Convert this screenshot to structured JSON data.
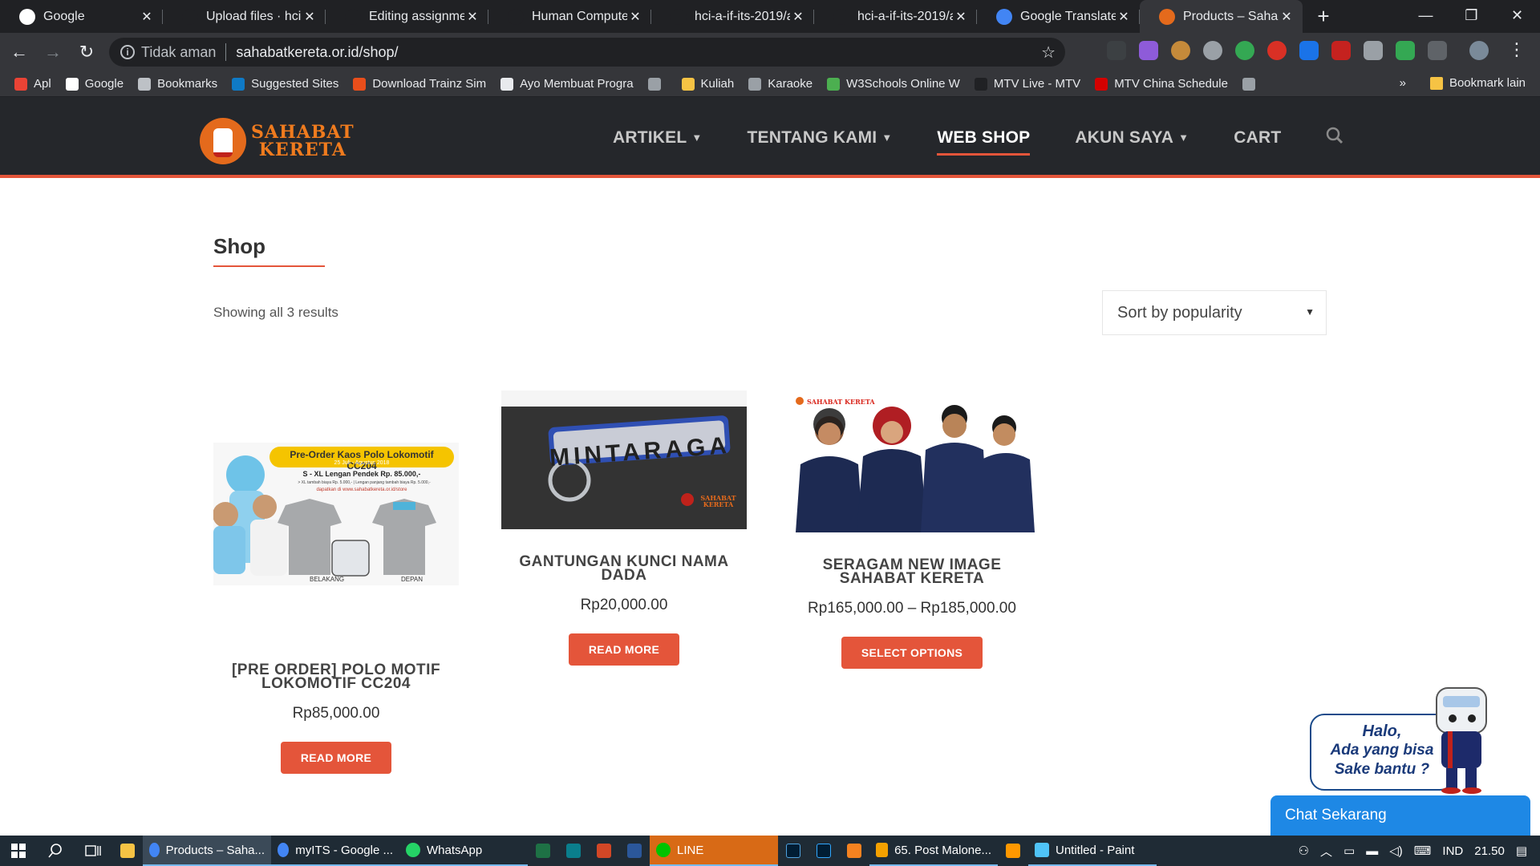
{
  "browser": {
    "tabs": [
      {
        "title": "Google",
        "icon": "google-icon",
        "color": "#ffffff"
      },
      {
        "title": "Upload files · hci-a",
        "icon": "github-icon",
        "color": "#202124"
      },
      {
        "title": "Editing assignment",
        "icon": "github-icon",
        "color": "#202124"
      },
      {
        "title": "Human Computer",
        "icon": "github-icon",
        "color": "#202124"
      },
      {
        "title": "hci-a-if-its-2019/a",
        "icon": "github-icon",
        "color": "#202124"
      },
      {
        "title": "hci-a-if-its-2019/a",
        "icon": "github-icon",
        "color": "#202124"
      },
      {
        "title": "Google Translate",
        "icon": "translate-icon",
        "color": "#4285f4"
      },
      {
        "title": "Products – Sahaba",
        "icon": "sahabat-kereta-icon",
        "color": "#e46a1c"
      }
    ],
    "close_glyph": "✕",
    "new_tab_glyph": "+",
    "address": {
      "security_label": "Tidak aman",
      "url": "sahabatkereta.or.id/shop/"
    },
    "bookmarks": [
      {
        "label": "Apl",
        "icon": "apps-icon",
        "color": "#ea4335"
      },
      {
        "label": "Google",
        "icon": "google-icon",
        "color": "#ffffff"
      },
      {
        "label": "Bookmarks",
        "icon": "star-icon",
        "color": "#bdc1c6"
      },
      {
        "label": "Suggested Sites",
        "icon": "bing-icon",
        "color": "#0f7ac6"
      },
      {
        "label": "Download Trainz Sim",
        "icon": "trainz-icon",
        "color": "#e94e1b"
      },
      {
        "label": "Ayo Membuat Progra",
        "icon": "wave-icon",
        "color": "#e8eaed"
      },
      {
        "label": "",
        "icon": "page-icon",
        "color": "#9aa0a6"
      },
      {
        "label": "Kuliah",
        "icon": "folder-icon",
        "color": "#f6c344"
      },
      {
        "label": "Karaoke",
        "icon": "page-icon",
        "color": "#9aa0a6"
      },
      {
        "label": "W3Schools Online W",
        "icon": "w3schools-icon",
        "color": "#4caf50"
      },
      {
        "label": "MTV Live - MTV",
        "icon": "mtv-icon",
        "color": "#202124"
      },
      {
        "label": "MTV China Schedule",
        "icon": "mtv-china-icon",
        "color": "#d40000"
      },
      {
        "label": "",
        "icon": "page-icon",
        "color": "#9aa0a6"
      }
    ],
    "bookmarks_overflow": "»",
    "other_bookmarks": "Bookmark lain"
  },
  "site": {
    "logo": {
      "line1": "SAHABAT",
      "line2": "KERETA"
    },
    "nav": [
      {
        "label": "ARTIKEL",
        "has_caret": true
      },
      {
        "label": "TENTANG KAMI",
        "has_caret": true
      },
      {
        "label": "WEB SHOP",
        "has_caret": false,
        "current": true
      },
      {
        "label": "AKUN SAYA",
        "has_caret": true
      },
      {
        "label": "CART",
        "has_caret": false
      }
    ],
    "accent_color": "#e4553a",
    "header_color": "#25272b"
  },
  "shop": {
    "title": "Shop",
    "result_count": "Showing all 3 results",
    "sort": {
      "selected": "Sort by popularity"
    },
    "products": [
      {
        "name_line1": "[PRE ORDER] POLO MOTIF",
        "name_line2": "LOKOMOTIF CC204",
        "price": "Rp85,000.00",
        "button": "READ MORE",
        "image": {
          "banner_title": "Pre-Order Kaos Polo Lokomotif CC204",
          "banner_date": "25 Juli - Agustus 2018",
          "banner_size": "S - XL Lengan Pendek Rp. 85.000,-",
          "banner_note": "> XL tambah biaya Rp. 5.000,- | Lengan panjang tambah biaya Rp. 5.000,-",
          "banner_link": "dapatkan di www.sahabatkereta.or.id/store",
          "label_back": "BELAKANG",
          "label_front": "DEPAN"
        }
      },
      {
        "name_line1": "GANTUNGAN KUNCI NAMA",
        "name_line2": "DADA",
        "price": "Rp20,000.00",
        "button": "READ MORE",
        "image": {
          "tag_text": "MINTARAGA",
          "brand": "SAHABAT KERETA"
        }
      },
      {
        "name_line1": "SERAGAM NEW IMAGE",
        "name_line2": "SAHABAT KERETA",
        "price": "Rp165,000.00 – Rp185,000.00",
        "button": "SELECT OPTIONS",
        "image": {
          "brand": "SAHABAT KERETA"
        }
      }
    ]
  },
  "chat": {
    "bubble_line1": "Halo,",
    "bubble_line2": "Ada yang bisa",
    "bubble_line3": "Sake bantu ?",
    "button": "Chat Sekarang"
  },
  "taskbar": {
    "apps": [
      {
        "label": "Products – Saha...",
        "icon": "chrome-icon",
        "color": "#4285f4",
        "active": true
      },
      {
        "label": "myITS - Google ...",
        "icon": "chrome-icon",
        "color": "#4285f4"
      },
      {
        "label": "WhatsApp",
        "icon": "whatsapp-icon",
        "color": "#25d366"
      },
      {
        "label": "LINE",
        "icon": "line-icon",
        "color": "#00c300",
        "highlight": "#d86a16"
      },
      {
        "label": "65. Post Malone...",
        "icon": "winamp-icon",
        "color": "#f4a100"
      },
      {
        "label": "Untitled - Paint",
        "icon": "paint-icon",
        "color": "#4fc3f7"
      }
    ],
    "tray": {
      "language": "IND",
      "time": "21.50"
    }
  }
}
